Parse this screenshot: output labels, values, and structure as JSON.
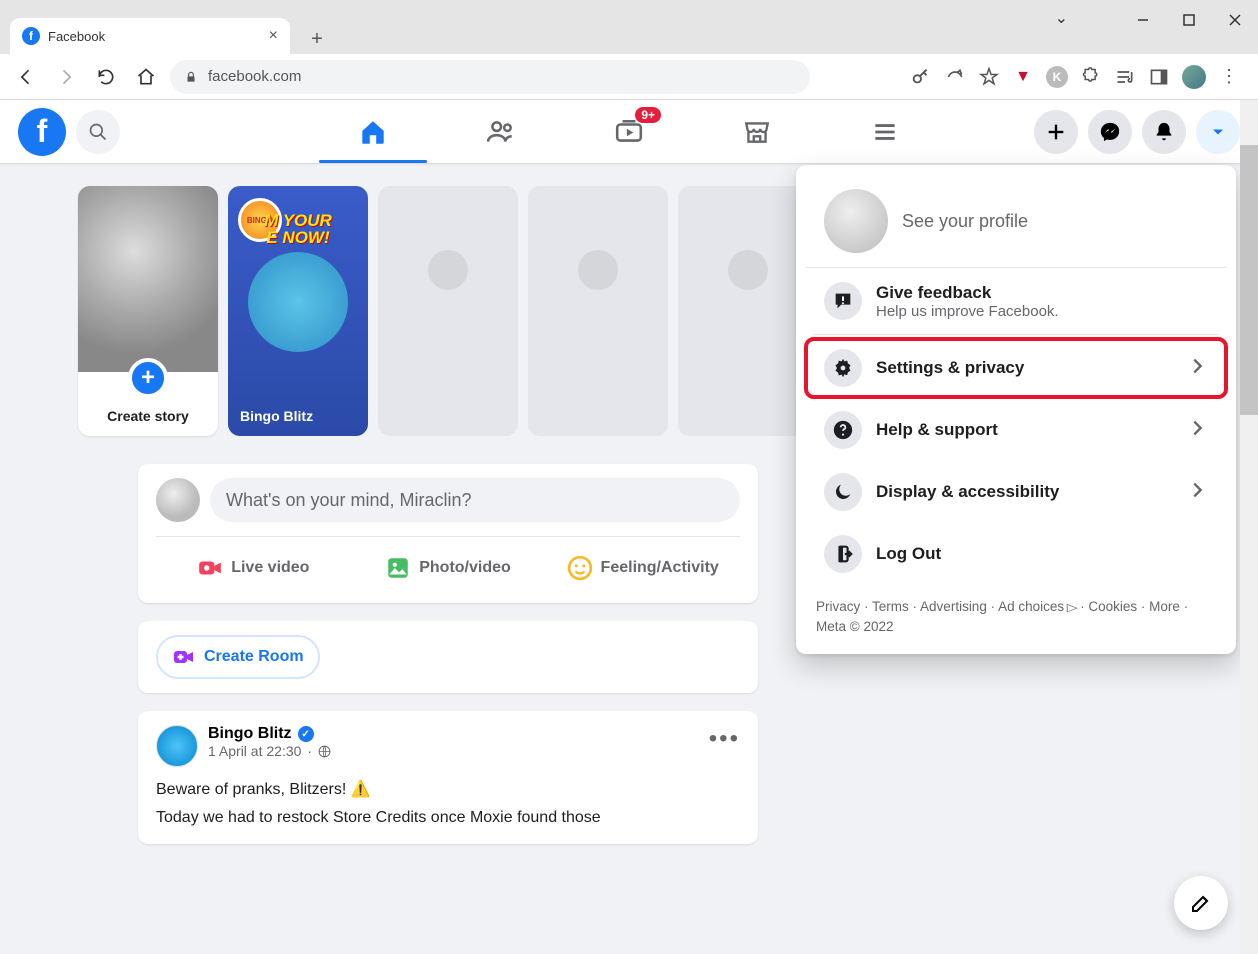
{
  "browser": {
    "tab_title": "Facebook",
    "url": "facebook.com"
  },
  "fb_nav": {
    "watch_badge": "9+"
  },
  "stories": {
    "create_label": "Create story",
    "bingo_overlay_1": "M YOUR",
    "bingo_overlay_2": "E NOW!",
    "bingo_label": "Bingo Blitz"
  },
  "composer": {
    "placeholder": "What's on your mind, Miraclin?",
    "live": "Live video",
    "photo": "Photo/video",
    "feeling": "Feeling/Activity"
  },
  "room": {
    "button": "Create Room"
  },
  "post": {
    "author": "Bingo Blitz",
    "time": "1 April at 22:30",
    "line1": "Beware of pranks, Blitzers! ⚠️",
    "line2": "Today we had to restock Store Credits once Moxie found those"
  },
  "menu": {
    "profile": "See your profile",
    "feedback_title": "Give feedback",
    "feedback_sub": "Help us improve Facebook.",
    "settings": "Settings & privacy",
    "help": "Help & support",
    "display": "Display & accessibility",
    "logout": "Log Out",
    "footer": {
      "privacy": "Privacy",
      "terms": "Terms",
      "advertising": "Advertising",
      "adchoices": "Ad choices",
      "cookies": "Cookies",
      "more": "More",
      "meta": "Meta © 2022"
    }
  }
}
